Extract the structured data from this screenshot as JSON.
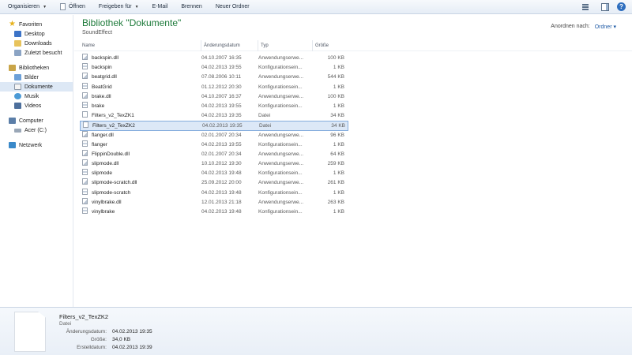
{
  "toolbar": {
    "organize": "Organisieren",
    "open": "Öffnen",
    "share": "Freigeben für",
    "email": "E-Mail",
    "burn": "Brennen",
    "new_folder": "Neuer Ordner"
  },
  "nav": {
    "favorites": "Favoriten",
    "favorite_items": [
      "Desktop",
      "Downloads",
      "Zuletzt besucht"
    ],
    "libraries": "Bibliotheken",
    "library_items": [
      "Bilder",
      "Dokumente",
      "Musik",
      "Videos"
    ],
    "computer": "Computer",
    "computer_items": [
      "Acer (C:)"
    ],
    "network": "Netzwerk"
  },
  "header": {
    "title": "Bibliothek \"Dokumente\"",
    "subtitle": "SoundEffect",
    "arrange_label": "Anordnen nach:",
    "arrange_value": "Ordner"
  },
  "columns": {
    "name": "Name",
    "date": "Änderungsdatum",
    "type": "Typ",
    "size": "Größe"
  },
  "files": [
    {
      "name": "backspin.dll",
      "date": "04.10.2007 16:35",
      "type": "Anwendungserwe...",
      "size": "100 KB",
      "icon": "dll"
    },
    {
      "name": "backspin",
      "date": "04.02.2013 19:55",
      "type": "Konfigurationsein...",
      "size": "1 KB",
      "icon": "cfg"
    },
    {
      "name": "beatgrid.dll",
      "date": "07.08.2006 10:11",
      "type": "Anwendungserwe...",
      "size": "544 KB",
      "icon": "dll"
    },
    {
      "name": "BeatGrid",
      "date": "01.12.2012 20:30",
      "type": "Konfigurationsein...",
      "size": "1 KB",
      "icon": "cfg"
    },
    {
      "name": "brake.dll",
      "date": "04.10.2007 16:37",
      "type": "Anwendungserwe...",
      "size": "100 KB",
      "icon": "dll"
    },
    {
      "name": "brake",
      "date": "04.02.2013 19:55",
      "type": "Konfigurationsein...",
      "size": "1 KB",
      "icon": "cfg"
    },
    {
      "name": "Filters_v2_TexZK1",
      "date": "04.02.2013 19:35",
      "type": "Datei",
      "size": "34 KB",
      "icon": "file"
    },
    {
      "name": "Filters_v2_TexZK2",
      "date": "04.02.2013 19:35",
      "type": "Datei",
      "size": "34 KB",
      "icon": "file",
      "selected": true
    },
    {
      "name": "flanger.dll",
      "date": "02.01.2007 20:34",
      "type": "Anwendungserwe...",
      "size": "96 KB",
      "icon": "dll"
    },
    {
      "name": "flanger",
      "date": "04.02.2013 19:55",
      "type": "Konfigurationsein...",
      "size": "1 KB",
      "icon": "cfg"
    },
    {
      "name": "FlippinDouble.dll",
      "date": "02.01.2007 20:34",
      "type": "Anwendungserwe...",
      "size": "64 KB",
      "icon": "dll"
    },
    {
      "name": "slipmode.dll",
      "date": "10.10.2012 19:30",
      "type": "Anwendungserwe...",
      "size": "259 KB",
      "icon": "dll"
    },
    {
      "name": "slipmode",
      "date": "04.02.2013 19:48",
      "type": "Konfigurationsein...",
      "size": "1 KB",
      "icon": "cfg"
    },
    {
      "name": "slipmode-scratch.dll",
      "date": "25.09.2012 20:00",
      "type": "Anwendungserwe...",
      "size": "261 KB",
      "icon": "dll"
    },
    {
      "name": "slipmode-scratch",
      "date": "04.02.2013 19:48",
      "type": "Konfigurationsein...",
      "size": "1 KB",
      "icon": "cfg"
    },
    {
      "name": "vinylbrake.dll",
      "date": "12.01.2013 21:18",
      "type": "Anwendungserwe...",
      "size": "263 KB",
      "icon": "dll"
    },
    {
      "name": "vinylbrake",
      "date": "04.02.2013 19:48",
      "type": "Konfigurationsein...",
      "size": "1 KB",
      "icon": "cfg"
    }
  ],
  "details": {
    "name": "Filters_v2_TexZK2",
    "type": "Datei",
    "modified_label": "Änderungsdatum:",
    "modified_value": "04.02.2013 19:35",
    "size_label": "Größe:",
    "size_value": "34,0 KB",
    "created_label": "Erstelldatum:",
    "created_value": "04.02.2013 19:39"
  }
}
